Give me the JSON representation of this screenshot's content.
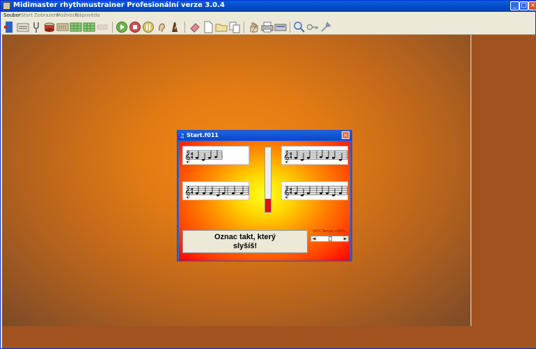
{
  "window": {
    "title": "Midimaster rhythmustrainer Profesionální verze 3.0.4",
    "controls": [
      "_",
      "□",
      "×"
    ]
  },
  "menu": {
    "items": [
      "Soubor",
      "Start",
      "Zobrazení",
      "Možnosti",
      "Nápověda"
    ]
  },
  "toolbar": {
    "icons": [
      "exit-door-icon",
      "staff-notes-icon",
      "tuning-fork-icon",
      "drum-icon",
      "keyboard-icon",
      "green-grid-icon",
      "green-grid-2-icon",
      "faded-icon",
      "play-icon",
      "stop-icon",
      "pause-icon",
      "ear-icon",
      "metronome-icon",
      "eraser-icon",
      "new-page-icon",
      "open-folder-icon",
      "copy-icon",
      "hand-icon",
      "printer-icon",
      "scanner-icon",
      "magnifier-icon",
      "key-icon",
      "tools-icon"
    ]
  },
  "dialog": {
    "title": "Start.f011",
    "close": "×",
    "prompt_line1": "Oznac takt, který",
    "prompt_line2": "slyšíš!",
    "tempo_label": "-50% Tempo +50%",
    "slider_left": "◄",
    "slider_right": "►",
    "level_fraction": 0.2
  },
  "colors": {
    "title_blue": "#0348c8",
    "workspace_orange": "#e07a14",
    "panel_brown": "#a2521e",
    "level_red": "#e01010"
  }
}
